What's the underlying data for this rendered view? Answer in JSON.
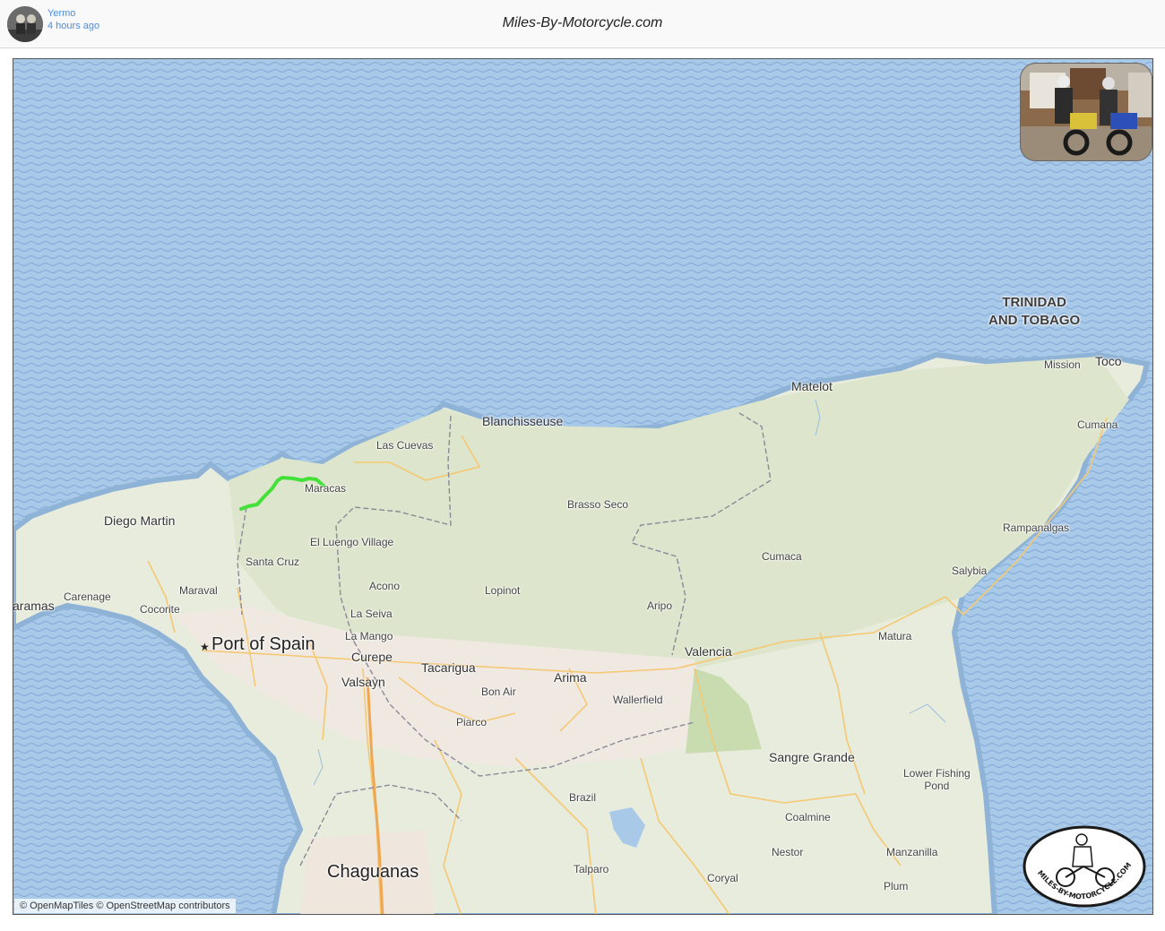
{
  "header": {
    "user_name": "Yermo",
    "timestamp": "4 hours ago",
    "site_title": "Miles-By-Motorcycle.com"
  },
  "map": {
    "country_label": [
      "TRINIDAD",
      "AND TOBAGO"
    ],
    "attribution": "© OpenMapTiles © OpenStreetMap contributors",
    "route_color": "#44e03a",
    "labels": {
      "port_of_spain": "Port of Spain",
      "chaguanas": "Chaguanas",
      "sangre_grande": "Sangre Grande",
      "diego_martin": "Diego Martin",
      "blanchisseuse": "Blanchisseuse",
      "matelot": "Matelot",
      "mission": "Mission",
      "toco": "Toco",
      "cumana": "Cumana",
      "las_cuevas": "Las Cuevas",
      "maracas": "Maracas",
      "brasso_seco": "Brasso Seco",
      "el_luengo_village": "El Luengo Village",
      "santa_cruz": "Santa Cruz",
      "maraval": "Maraval",
      "carenage": "Carenage",
      "aramas": "aramas",
      "cocorite": "Cocorite",
      "acono": "Acono",
      "lopinot": "Lopinot",
      "la_seiva": "La Seiva",
      "la_mango": "La Mango",
      "curepe": "Curepe",
      "valsayn": "Valsayn",
      "tacarigua": "Tacarigua",
      "bon_air": "Bon Air",
      "arima": "Arima",
      "wallerfield": "Wallerfield",
      "piarco": "Piarco",
      "aripo": "Aripo",
      "valencia": "Valencia",
      "cumaca": "Cumaca",
      "rampanalgas": "Rampanalgas",
      "salybia": "Salybia",
      "matura": "Matura",
      "lower_fishing_pond": [
        "Lower Fishing",
        "Pond"
      ],
      "brazil": "Brazil",
      "coalmine": "Coalmine",
      "nestor": "Nestor",
      "manzanilla": "Manzanilla",
      "talparo": "Talparo",
      "coryal": "Coryal",
      "plum": "Plum"
    },
    "logo_text": "MILES-BY-MOTORCYCLE.COM"
  }
}
